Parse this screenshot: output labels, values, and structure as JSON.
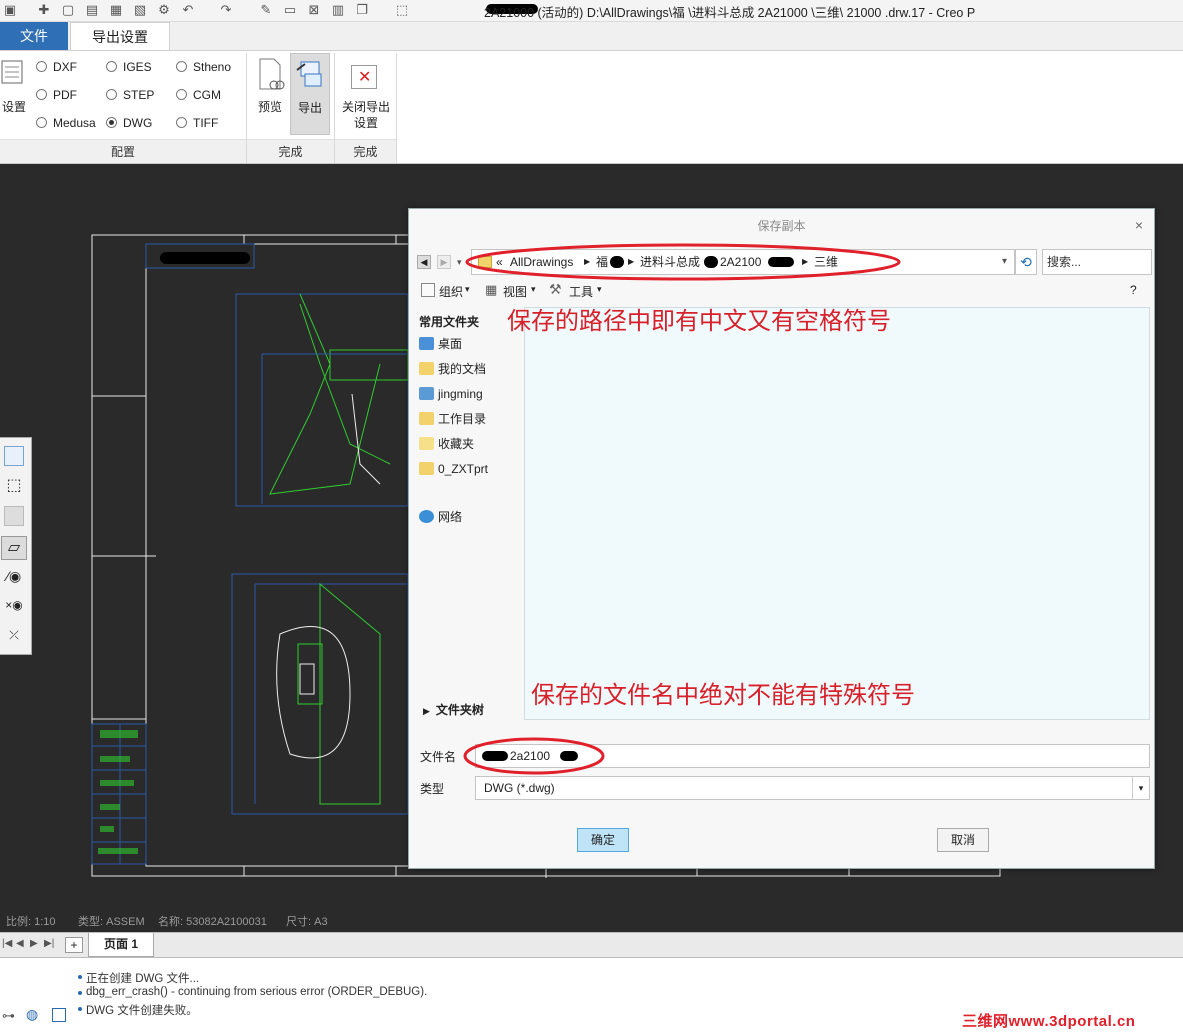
{
  "window": {
    "title": "2A21000   (活动的) D:\\AllDrawings\\福   \\进料斗总成   2A21000   \\三维\\   21000   .drw.17 - Creo P"
  },
  "tabs": {
    "file": "文件",
    "export_settings": "导出设置"
  },
  "ribbon": {
    "settings_label": "设置",
    "formats": [
      "DXF",
      "IGES",
      "Stheno",
      "PDF",
      "STEP",
      "CGM",
      "Medusa",
      "DWG",
      "TIFF"
    ],
    "selected_format": "DWG",
    "config_group": "配置",
    "preview_label": "预览",
    "export_label": "导出",
    "complete_group_1": "完成",
    "close_export_line1": "关闭导出",
    "close_export_line2": "设置",
    "complete_group_2": "完成"
  },
  "status": {
    "scale": "比例: 1:10",
    "type": "类型: ASSEM",
    "name": "名称: 53082A2100031",
    "size": "尺寸: A3"
  },
  "page_tabs": {
    "add": "+",
    "page1": "页面 1"
  },
  "messages": [
    "正在创建 DWG 文件...",
    "dbg_err_crash() - continuing from serious error (ORDER_DEBUG).",
    "DWG 文件创建失败。"
  ],
  "watermark": "三维网www.3dportal.cn",
  "dialog": {
    "title": "保存副本",
    "close": "×",
    "breadcrumb": [
      "«",
      "AllDrawings",
      "福",
      "进料斗总成",
      "2A2100",
      "三维"
    ],
    "search_placeholder": "搜索...",
    "organize": "组织",
    "view": "视图",
    "tools": "工具",
    "help": "?",
    "common_folders": "常用文件夹",
    "folders": [
      "桌面",
      "我的文档",
      "jingming",
      "工作目录",
      "收藏夹",
      "0_ZXTprt"
    ],
    "network": "网络",
    "folder_tree": "文件夹树",
    "file_name_label": "文件名",
    "file_name_value": "2a2100",
    "type_label": "类型",
    "type_value": "DWG (*.dwg)",
    "ok": "确定",
    "cancel": "取消"
  },
  "annotations": {
    "path_note": "保存的路径中即有中文又有空格符号",
    "filename_note": "保存的文件名中绝对不能有特殊符号"
  },
  "colors": {
    "file_tab": "#2f6fb5",
    "annotation_red": "#d8202a",
    "drawing_green": "#2fcc2f",
    "drawing_blue": "#2a58a8",
    "ok_button": "#bfe3f7"
  }
}
